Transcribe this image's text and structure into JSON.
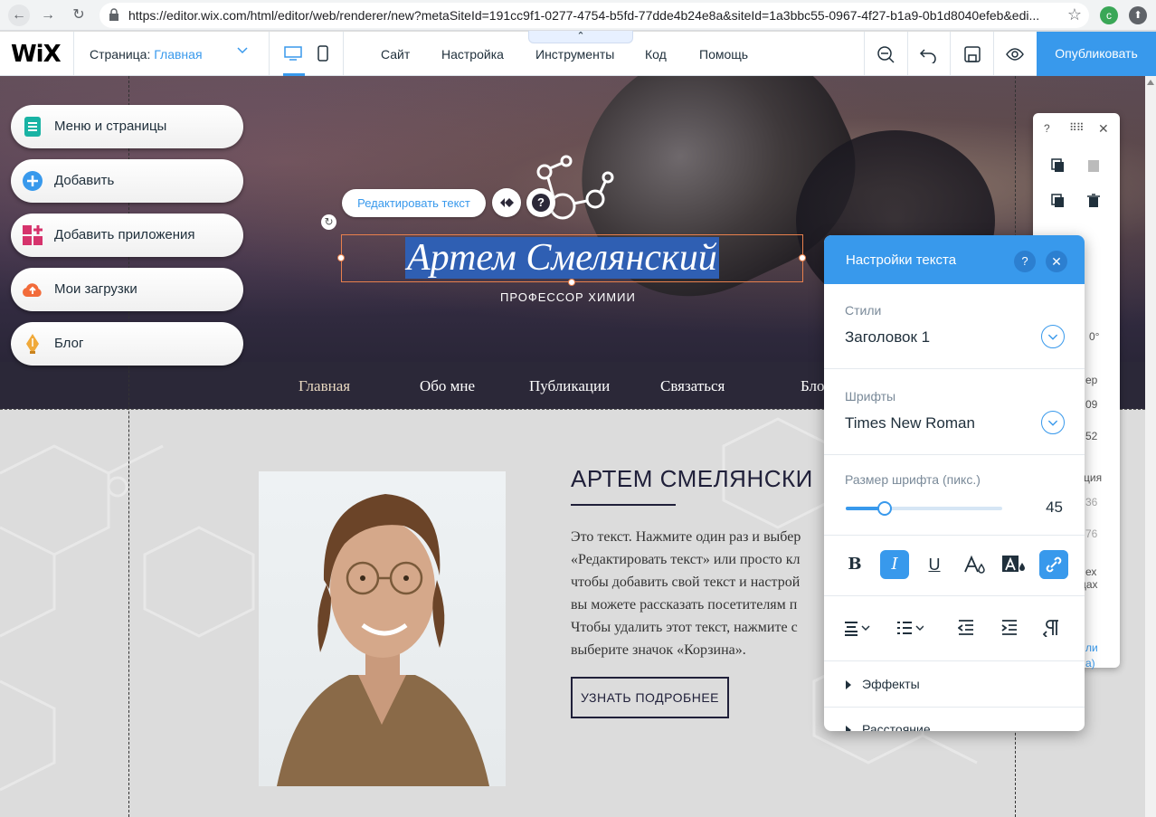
{
  "browser": {
    "url": "https://editor.wix.com/html/editor/web/renderer/new?metaSiteId=191cc9f1-0277-4754-b5fd-77dde4b24e8a&siteId=1a3bbc55-0967-4f27-b1a9-0b1d8040efeb&edi...",
    "profile_initial": "c"
  },
  "topbar": {
    "logo": "WiX",
    "page_label": "Страница:",
    "page_value": "Главная",
    "menu": [
      "Сайт",
      "Настройка",
      "Инструменты",
      "Код",
      "Помощь"
    ],
    "publish": "Опубликовать",
    "collapse_glyph": "⌃"
  },
  "left_panel": [
    {
      "label": "Меню и страницы",
      "icon": "pages-icon",
      "color": "#19b3a4"
    },
    {
      "label": "Добавить",
      "icon": "plus-icon",
      "color": "#3899ec"
    },
    {
      "label": "Добавить приложения",
      "icon": "apps-icon",
      "color": "#d6336c"
    },
    {
      "label": "Мои загрузки",
      "icon": "cloud-upload-icon",
      "color": "#f26b3a"
    },
    {
      "label": "Блог",
      "icon": "pen-nib-icon",
      "color": "#f0a93a"
    }
  ],
  "hero": {
    "edit_text_button": "Редактировать текст",
    "heading": "Артем Смелянский",
    "subtitle": "ПРОФЕССОР ХИМИИ"
  },
  "site_nav": [
    "Главная",
    "Обо мне",
    "Публикации",
    "Связаться",
    "Бло"
  ],
  "about": {
    "title": "АРТЕМ СМЕЛЯНСКИ",
    "text_lines": [
      "Это текст. Нажмите один раз и выбер",
      "«Редактировать текст» или просто кл",
      "чтобы добавить свой текст и настрой",
      "вы можете рассказать посетителям п",
      "Чтобы удалить этот текст, нажмите с",
      "выберите значок «Корзина»."
    ],
    "button": "УЗНАТЬ ПОДРОБНЕЕ"
  },
  "float_toolbar": {
    "help": "?",
    "items": [
      "0°",
      "ер",
      "09",
      "52",
      "ция",
      "36",
      "76",
      "ех",
      "цах",
      "ли",
      "а)"
    ]
  },
  "text_settings": {
    "title": "Настройки текста",
    "styles_label": "Стили",
    "styles_value": "Заголовок 1",
    "fonts_label": "Шрифты",
    "fonts_value": "Times New Roman",
    "size_label": "Размер шрифта (пикс.)",
    "size_value": "45",
    "size_fraction": 0.25,
    "format_buttons": [
      {
        "label": "B",
        "name": "bold-button",
        "on": false
      },
      {
        "label": "I",
        "name": "italic-button",
        "on": true
      },
      {
        "label": "U",
        "name": "underline-button",
        "on": false
      }
    ],
    "effects": "Эффекты",
    "spacing": "Расстояние"
  }
}
